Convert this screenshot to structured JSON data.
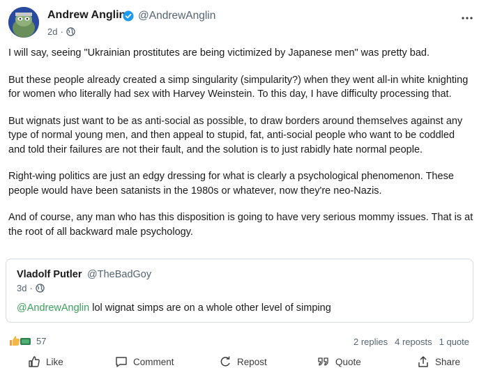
{
  "post": {
    "author_name": "Andrew Anglin",
    "author_handle": "@AndrewAnglin",
    "time": "2d",
    "separator": "·",
    "paragraphs": [
      "I will say, seeing \"Ukrainian prostitutes are being victimized by Japanese men\" was pretty bad.",
      "But these people already created a simp singularity (simpularity?) when they went all-in white knighting for women who literally had sex with Harvey Weinstein. To this day, I have difficulty processing that.",
      "But wignats just want to be as anti-social as possible, to draw borders around themselves against any type of normal young men, and then appeal to stupid, fat, anti-social people who want to be coddled and told their failures are not their fault, and the solution is to just rabidly hate normal people.",
      "Right-wing politics are just an edgy dressing for what is clearly a psychological phenomenon. These people would have been satanists in the 1980s or whatever, now they're neo-Nazis.",
      "And of course, any man who has this disposition is going to have very serious mommy issues. That is at the root of all backward male psychology."
    ]
  },
  "quoted": {
    "author_name": "Vladolf Putler",
    "author_handle": "@TheBadGoy",
    "time": "3d",
    "mention": "@AndrewAnglin",
    "text": " lol wignat simps are on a whole other level of simping"
  },
  "engagement": {
    "reaction_count": "57",
    "replies": "2 replies",
    "reposts": "4 reposts",
    "quotes": "1 quote"
  },
  "actions": {
    "like": "Like",
    "comment": "Comment",
    "repost": "Repost",
    "quote": "Quote",
    "share": "Share"
  },
  "colors": {
    "verified": "#1d9bf0",
    "mention": "#3aa05a",
    "secondary_text": "#536471"
  }
}
